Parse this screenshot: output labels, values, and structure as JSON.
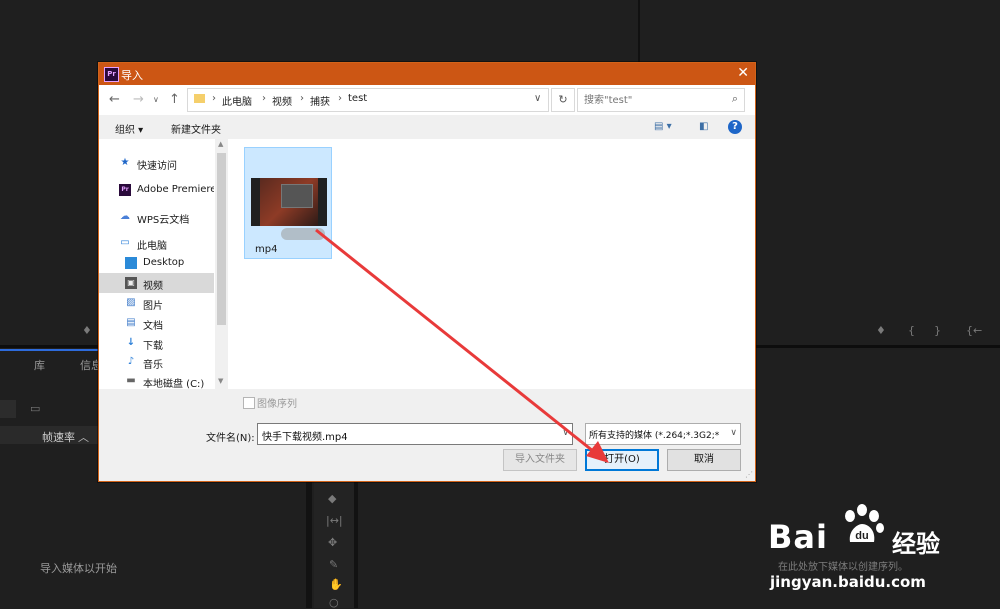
{
  "background": {
    "panel_tabs": [
      "库",
      "信息"
    ],
    "frame_rate_label": "帧速率",
    "import_hint": "导入媒体以开始",
    "timeline_hint": "在此处放下媒体以创建序列。",
    "playhead_icons": [
      "{",
      "}",
      "{←"
    ]
  },
  "dialog": {
    "title": "导入",
    "app_icon_label": "Pr",
    "close_glyph": "✕",
    "breadcrumbs": [
      "此电脑",
      "视频",
      "捕获",
      "test"
    ],
    "search_placeholder": "搜索\"test\"",
    "toolbar": {
      "organize": "组织 ▾",
      "new_folder": "新建文件夹"
    },
    "nav_items": [
      {
        "label": "快速访问",
        "icon": "star-icon"
      },
      {
        "label": "Adobe Premiere",
        "icon": "premiere-icon"
      },
      {
        "label": "WPS云文档",
        "icon": "cloud-icon"
      },
      {
        "label": "此电脑",
        "icon": "computer-icon"
      },
      {
        "label": "Desktop",
        "icon": "desktop-icon"
      },
      {
        "label": "视频",
        "icon": "video-icon"
      },
      {
        "label": "图片",
        "icon": "picture-icon"
      },
      {
        "label": "文档",
        "icon": "document-icon"
      },
      {
        "label": "下载",
        "icon": "download-icon"
      },
      {
        "label": "音乐",
        "icon": "music-icon"
      },
      {
        "label": "本地磁盘 (C:)",
        "icon": "drive-icon"
      }
    ],
    "file": {
      "label": "mp4"
    },
    "image_sequence_label": "图像序列",
    "filename_label": "文件名(N):",
    "filename_value": "快手下载视频.mp4",
    "filter_value": "所有支持的媒体 (*.264;*.3G2;*",
    "buttons": {
      "import_folder": "导入文件夹",
      "open": "打开(O)",
      "cancel": "取消"
    }
  },
  "watermark": {
    "brand": "Bai",
    "brand_cn": "经验",
    "url": "jingyan.baidu.com"
  },
  "colors": {
    "titlebar": "#cc5614",
    "selection": "#cce8ff",
    "arrow": "#e83a3a"
  }
}
